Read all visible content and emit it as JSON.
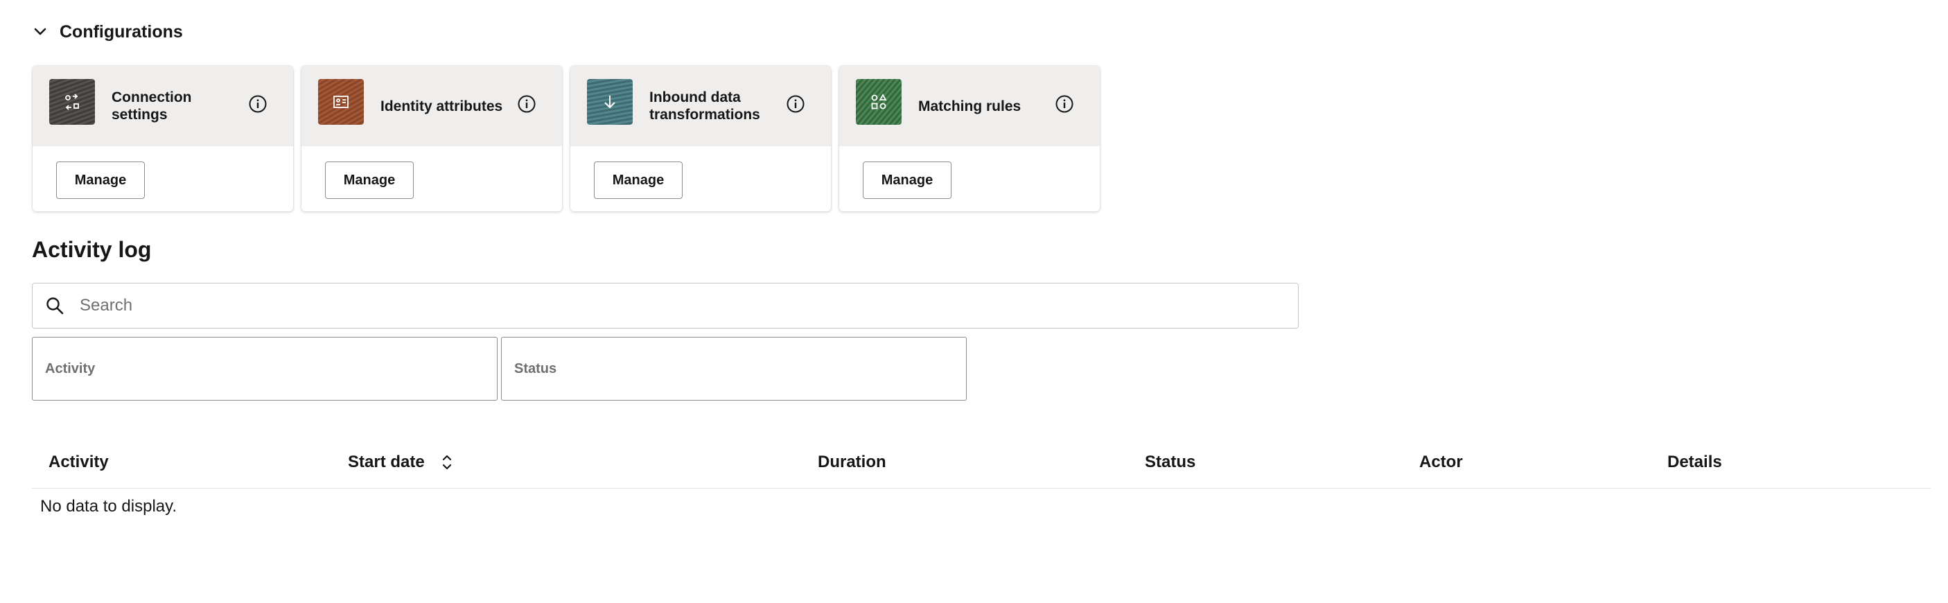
{
  "configurations": {
    "title": "Configurations",
    "cards": [
      {
        "title": "Connection settings",
        "icon": "connection-settings-icon",
        "button": "Manage"
      },
      {
        "title": "Identity attributes",
        "icon": "identity-card-icon",
        "button": "Manage"
      },
      {
        "title": "Inbound data transformations",
        "icon": "arrow-down-icon",
        "button": "Manage"
      },
      {
        "title": "Matching rules",
        "icon": "shapes-icon",
        "button": "Manage"
      }
    ]
  },
  "activity_log": {
    "title": "Activity log",
    "search": {
      "placeholder": "Search",
      "value": ""
    },
    "filters": {
      "activity": "Activity",
      "status": "Status"
    },
    "columns": {
      "activity": "Activity",
      "start_date": "Start date",
      "duration": "Duration",
      "status": "Status",
      "actor": "Actor",
      "details": "Details"
    },
    "empty_message": "No data to display."
  }
}
